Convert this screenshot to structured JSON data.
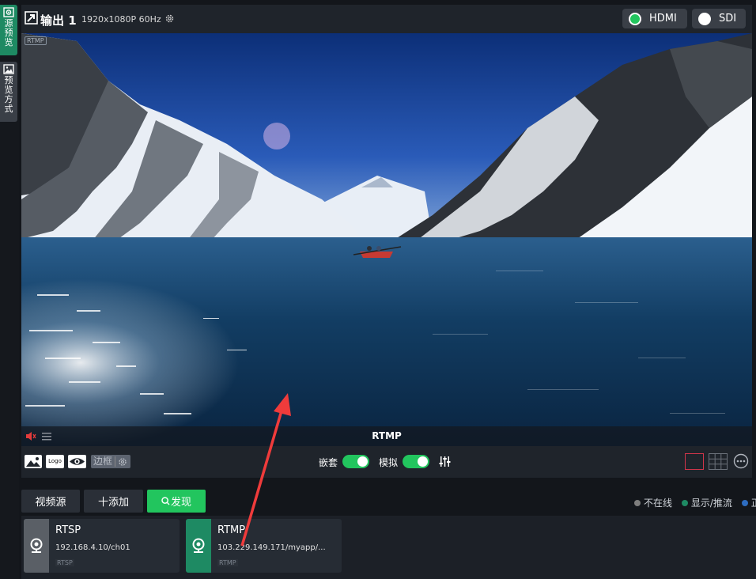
{
  "left_tabs": [
    {
      "label": "源预览",
      "icon": "eye-icon"
    },
    {
      "label": "预览方式",
      "icon": "image-icon"
    }
  ],
  "output": {
    "title": "输出 1",
    "resolution": "1920x1080P 60Hz",
    "hdmi_label": "HDMI",
    "sdi_label": "SDI",
    "hdmi_status_color": "#22c55e"
  },
  "preview": {
    "watermark": "RTMP",
    "source_label": "RTMP"
  },
  "toolbar": {
    "logo_label": "Logo",
    "border_label": "边框",
    "embed_label": "嵌套",
    "embed_on": true,
    "analog_label": "模拟",
    "analog_on": true
  },
  "sources": {
    "tab_video_source": "视频源",
    "add_label": "十添加",
    "discover_label": "发现",
    "legend": [
      {
        "label": "不在线",
        "color": "#7d7d7d"
      },
      {
        "label": "显示/推流",
        "color": "#1e8a63"
      },
      {
        "label": "正",
        "color": "#2d6cc0"
      }
    ],
    "cards": [
      {
        "name": "RTSP",
        "address": "192.168.4.10/ch01",
        "tag": "RTSP",
        "status_color": "#5a5f66"
      },
      {
        "name": "RTMP",
        "address": "103.229.149.171/myapp/...",
        "tag": "RTMP",
        "status_color": "#1e8a63"
      }
    ]
  },
  "colors": {
    "accent_green": "#22c55e",
    "active_green": "#1e8a63",
    "annotation_red": "#ef3b3b"
  }
}
